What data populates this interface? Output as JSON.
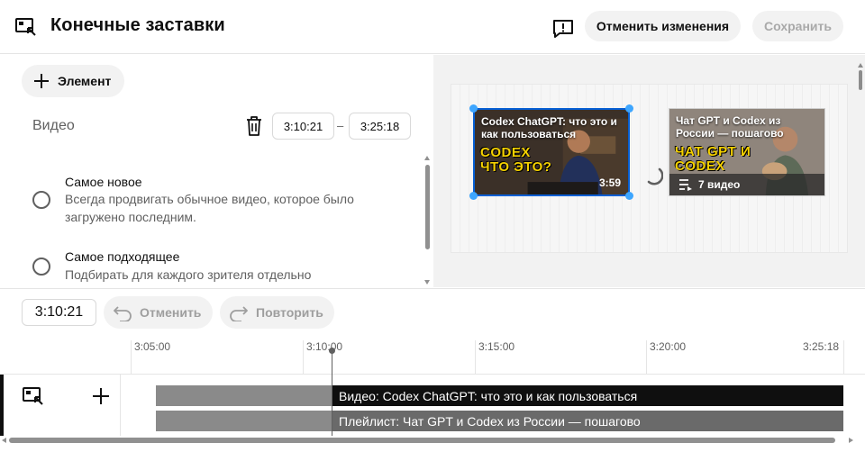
{
  "header": {
    "title": "Конечные заставки",
    "discard_label": "Отменить изменения",
    "save_label": "Сохранить",
    "icon": "end-screen-icon",
    "feedback_icon": "feedback-icon"
  },
  "editor": {
    "add_element_label": "Элемент",
    "element_type_label": "Видео",
    "start_time": "3:10:21",
    "end_time": "3:25:18",
    "dash": "–",
    "options": [
      {
        "title": "Самое новое",
        "description": "Всегда продвигать обычное видео, которое было загружено последним."
      },
      {
        "title": "Самое подходящее",
        "description": "Подбирать для каждого зрителя отдельно"
      }
    ]
  },
  "preview": {
    "video_card": {
      "title": "Codex ChatGPT: что это и как пользоваться",
      "caption": "CODEX ЧТО ЭТО?",
      "duration": "3:59"
    },
    "playlist_card": {
      "title": "Чат GPT и Codex из России — пошагово",
      "caption": "ЧАТ GPT И CODEX",
      "count": "7 видео"
    }
  },
  "controls": {
    "current_time": "3:10:21",
    "undo_label": "Отменить",
    "redo_label": "Повторить"
  },
  "timeline": {
    "ticks": [
      "3:05:00",
      "3:10:00",
      "3:15:00",
      "3:20:00",
      "3:25:18"
    ],
    "video_track_label": "Видео: Codex ChatGPT: что это и как пользоваться",
    "playlist_track_label": "Плейлист: Чат GPT и Codex из России — пошагово"
  },
  "colors": {
    "accent": "#065fd4",
    "handle": "#3ea6ff",
    "thumbnail_yellow": "#f5d100"
  }
}
